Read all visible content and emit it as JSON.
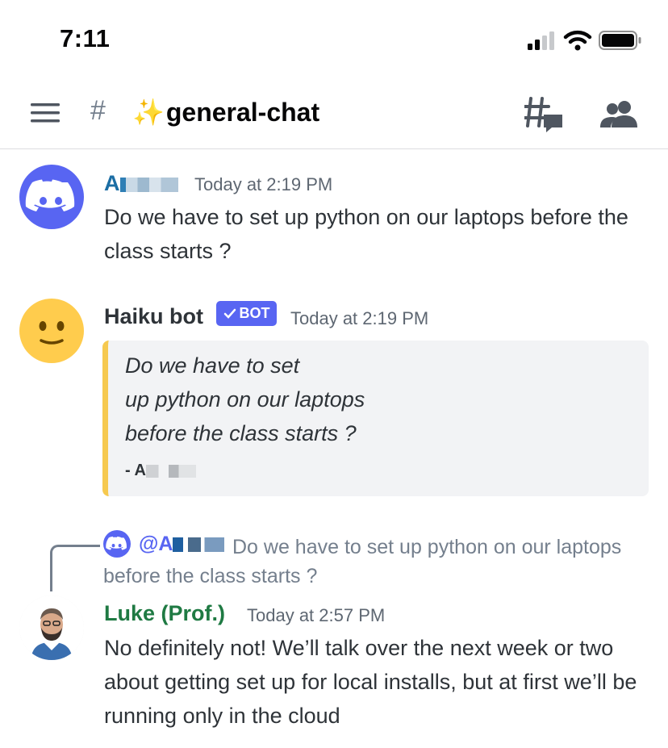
{
  "status_bar": {
    "time": "7:11"
  },
  "header": {
    "channel_prefix": "#",
    "channel_name": "general-chat",
    "channel_emoji": "✨",
    "icons": [
      "hamburger-menu-icon",
      "threads-icon",
      "members-icon"
    ]
  },
  "messages": [
    {
      "author": "A",
      "timestamp": "Today at 2:19 PM",
      "text": "Do we have to set up python on our laptops before the class starts ?",
      "author_color": "#1c6ea4",
      "avatar": "discord-logo-icon",
      "avatar_color": "#5865f2"
    },
    {
      "author": "Haiku bot",
      "badge": "BOT",
      "timestamp": "Today at 2:19 PM",
      "author_color": "#2e3338",
      "avatar": "slight-smile-emoji-icon",
      "avatar_color": "#ffcc4d",
      "embed": {
        "lines": [
          "Do we have to set",
          "up python on our laptops",
          "before the class starts ?"
        ],
        "footer": "- A",
        "accent": "#f6c94f"
      }
    },
    {
      "reply": {
        "mention": "@A",
        "text": "Do we have to set up python on our laptops before the class starts ?"
      },
      "author": "Luke (Prof.)",
      "timestamp": "Today at 2:57 PM",
      "text": "No definitely not! We’ll talk over the next week or two about getting set up for local installs, but at first we’ll be running only in the cloud",
      "author_color": "#1f7a43",
      "avatar": "profile-photo"
    }
  ]
}
